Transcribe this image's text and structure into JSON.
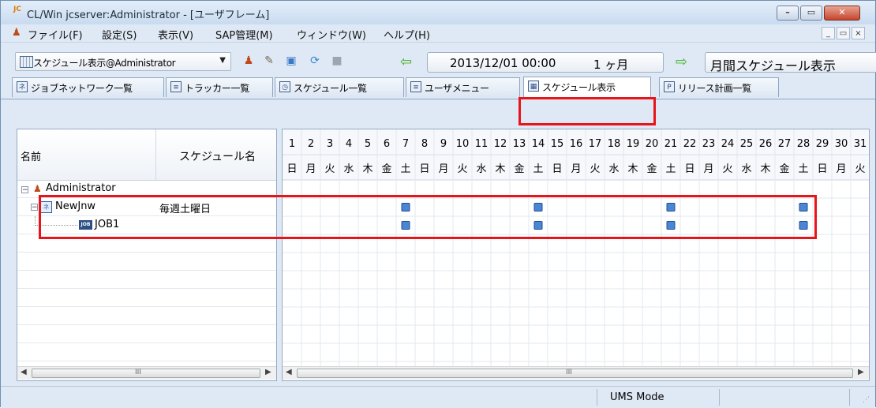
{
  "window": {
    "title": "CL/Win jcserver:Administrator - [ユーザフレーム]",
    "app_icon": "JC"
  },
  "window_controls": {
    "minimize": "–",
    "maximize": "▭",
    "close": "✕"
  },
  "mdi_controls": {
    "minimize": "_",
    "restore": "▭",
    "close": "×"
  },
  "menu": {
    "items": [
      "ファイル(F)",
      "設定(S)",
      "表示(V)",
      "SAP管理(M)",
      "ウィンドウ(W)",
      "ヘルプ(H)"
    ]
  },
  "toolbar": {
    "combo_value": "スケジュール表示@Administrator",
    "date": "2013/12/01 00:00",
    "period": "1 ヶ月",
    "mode": "月間スケジュール表示"
  },
  "tabs": [
    {
      "label": "ジョブネットワーク一覧",
      "icon": "jobnet-icon",
      "glyph": "ネ"
    },
    {
      "label": "トラッカー一覧",
      "icon": "tracker-icon",
      "glyph": "≡"
    },
    {
      "label": "スケジュール一覧",
      "icon": "schedule-icon",
      "glyph": "◷"
    },
    {
      "label": "ユーザメニュー",
      "icon": "user-menu-icon",
      "glyph": "≡"
    },
    {
      "label": "スケジュール表示",
      "icon": "calendar-icon",
      "glyph": "▦"
    },
    {
      "label": "リリース計画一覧",
      "icon": "release-plan-icon",
      "glyph": "P"
    }
  ],
  "active_tab": "スケジュール表示",
  "list": {
    "col_name": "名前",
    "col_schedule": "スケジュール名",
    "rows": [
      {
        "name": "Administrator",
        "schedule": "",
        "type": "user"
      },
      {
        "name": "NewJnw",
        "schedule": "毎週土曜日",
        "type": "jobnet"
      },
      {
        "name": "JOB1",
        "schedule": "",
        "type": "job"
      }
    ]
  },
  "calendar": {
    "days": [
      "1",
      "2",
      "3",
      "4",
      "5",
      "6",
      "7",
      "8",
      "9",
      "10",
      "11",
      "12",
      "13",
      "14",
      "15",
      "16",
      "17",
      "18",
      "19",
      "20",
      "21",
      "22",
      "23",
      "24",
      "25",
      "26",
      "27",
      "28",
      "29",
      "30",
      "31"
    ],
    "weekdays": [
      "日",
      "月",
      "火",
      "水",
      "木",
      "金",
      "土",
      "日",
      "月",
      "火",
      "水",
      "木",
      "金",
      "土",
      "日",
      "月",
      "火",
      "水",
      "木",
      "金",
      "土",
      "日",
      "月",
      "火",
      "水",
      "木",
      "金",
      "土",
      "日",
      "月",
      "火"
    ],
    "marked_days": [
      7,
      14,
      21,
      28
    ],
    "marker_color": "#4a86d4"
  },
  "job_icon_text": "JOB",
  "scrollbar_grip": "III",
  "status": {
    "mode": "UMS Mode"
  },
  "colors": {
    "highlight": "#e8141a",
    "accent": "#2d5fa8"
  }
}
